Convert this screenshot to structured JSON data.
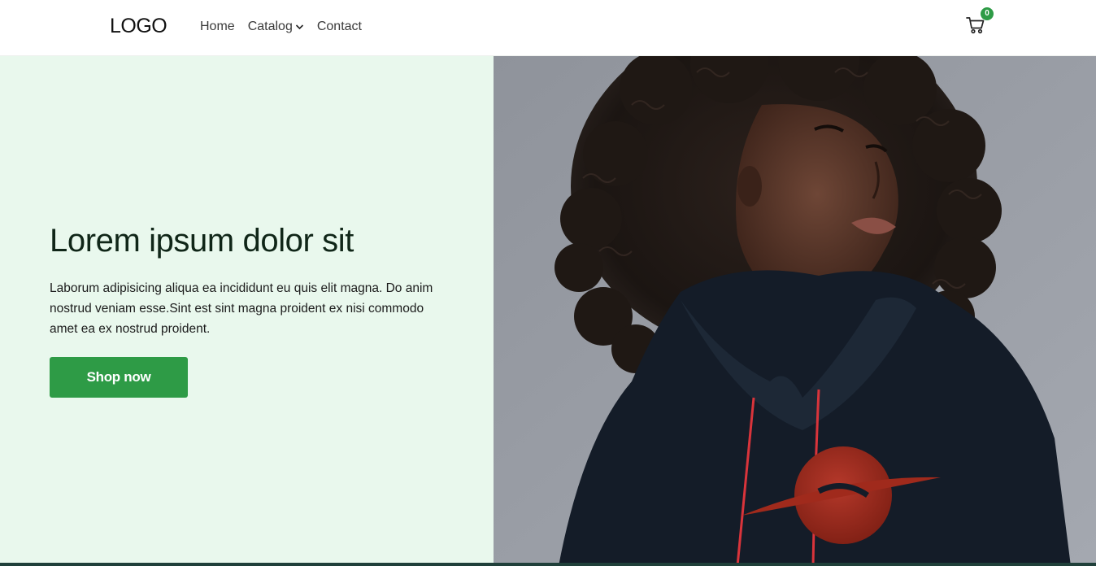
{
  "header": {
    "logo": "LOGO",
    "nav": [
      {
        "label": "Home"
      },
      {
        "label": "Catalog"
      },
      {
        "label": "Contact"
      }
    ],
    "cart_count": "0",
    "cart_icon": "cart-icon"
  },
  "hero": {
    "title": "Lorem ipsum dolor sit",
    "description": "Laborum adipisicing aliqua ea incididunt eu quis elit magna. Do anim nostrud veniam esse.Sint est sint magna proident ex nisi commodo amet ea ex nostrud proident.",
    "button_label": "Shop now",
    "image": "woman in black hoodie with red planet logo"
  },
  "colors": {
    "accent": "#2e9b46",
    "hero_bg": "#e9f8ed",
    "photo_bg": "#979ba3",
    "hoodie": "#141c28",
    "planet": "#a02a1c"
  }
}
